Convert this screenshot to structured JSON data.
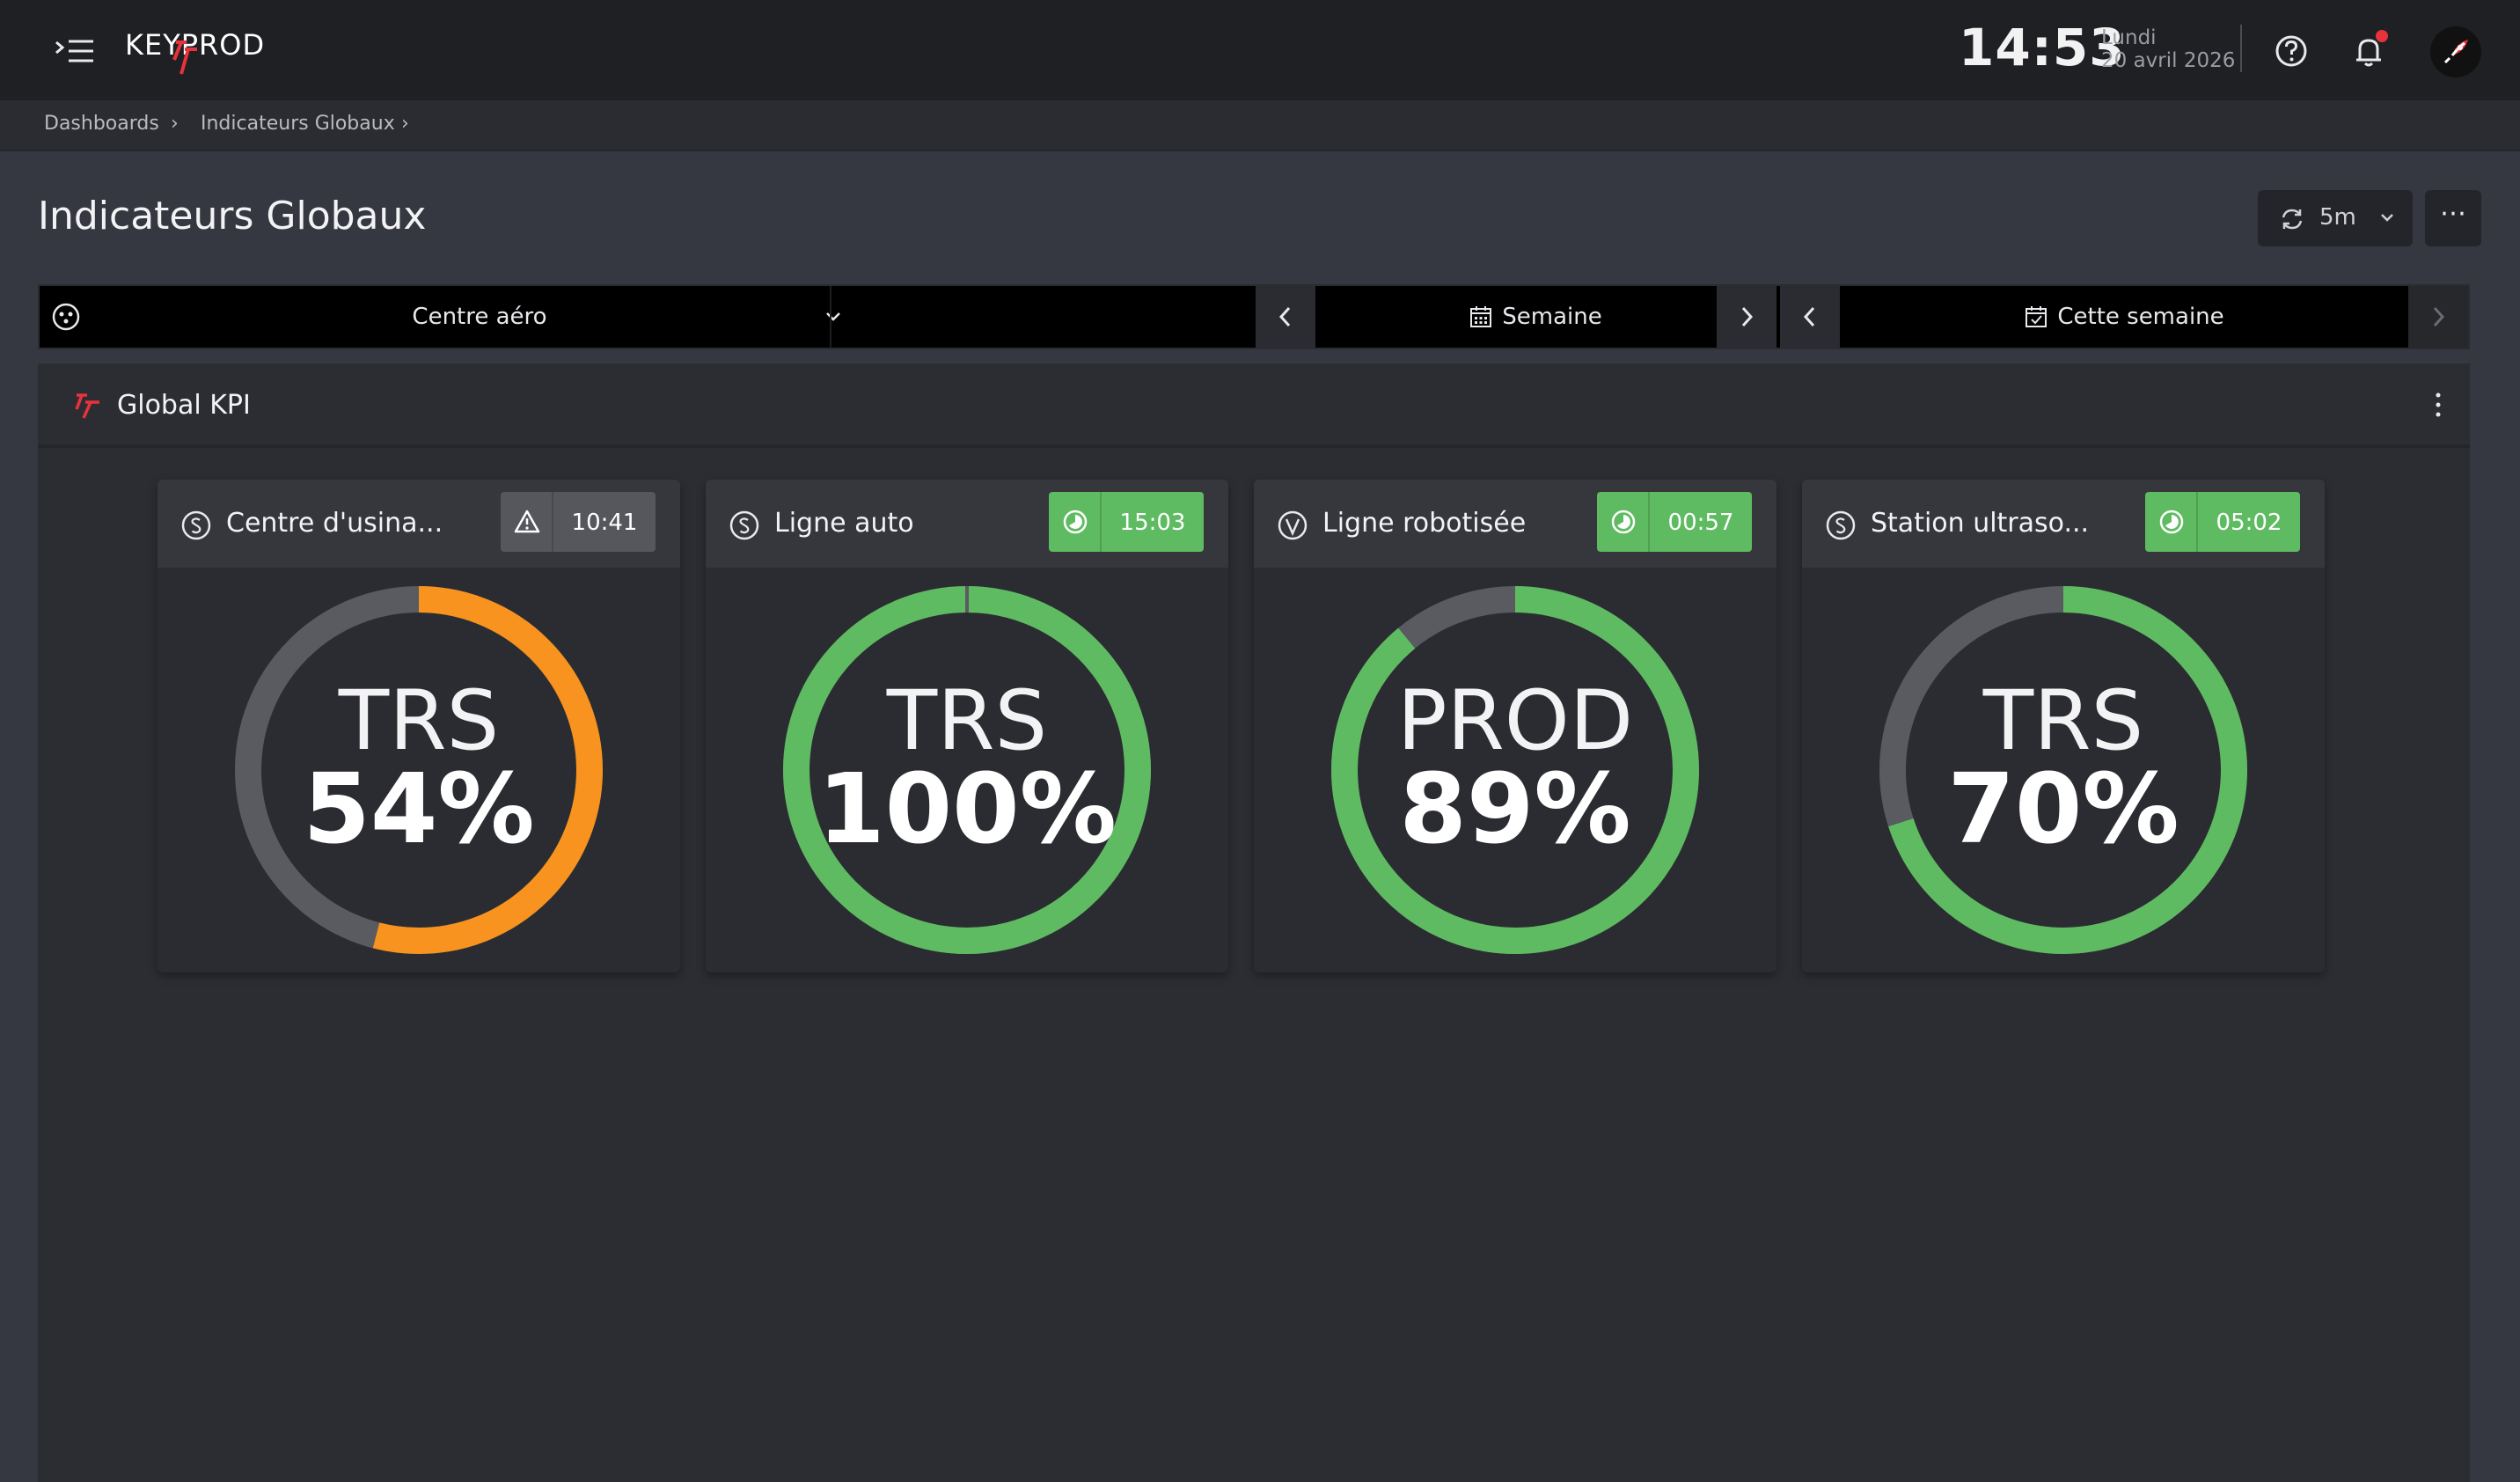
{
  "app": {
    "brand": "KEYPROD"
  },
  "topbar": {
    "time": "14:53",
    "day": "Lundi",
    "date": "20 avril 2026"
  },
  "breadcrumb": [
    {
      "label": "Dashboards"
    },
    {
      "label": "Indicateurs Globaux"
    }
  ],
  "page": {
    "title": "Indicateurs Globaux",
    "refresh_interval": "5m",
    "more_label": "⋯"
  },
  "filters": {
    "site": "Centre aéro",
    "period_type": "Semaine",
    "period": "Cette semaine"
  },
  "panel": {
    "title": "Global KPI"
  },
  "cards": [
    {
      "title": "Centre d'usina...",
      "icon": "s-circle-icon",
      "badge_time": "10:41",
      "badge_status": "warning",
      "badge_icon": "warning-triangle-icon",
      "badge_color": "#55575d",
      "kpi_label": "TRS",
      "kpi_value": "54%",
      "kpi_fraction": 0.54,
      "ring_color": "#f7931e"
    },
    {
      "title": "Ligne auto",
      "icon": "s-circle-icon",
      "badge_time": "15:03",
      "badge_status": "running",
      "badge_icon": "half-moon-icon",
      "badge_color": "#5fbb61",
      "kpi_label": "TRS",
      "kpi_value": "100%",
      "kpi_fraction": 1.0,
      "ring_color": "#5fbb61"
    },
    {
      "title": "Ligne robotisée",
      "icon": "v-circle-icon",
      "badge_time": "00:57",
      "badge_status": "running",
      "badge_icon": "half-moon-icon",
      "badge_color": "#5fbb61",
      "kpi_label": "PROD",
      "kpi_value": "89%",
      "kpi_fraction": 0.89,
      "ring_color": "#5fbb61"
    },
    {
      "title": "Station ultraso...",
      "icon": "s-circle-icon",
      "badge_time": "05:02",
      "badge_status": "running",
      "badge_icon": "half-moon-icon",
      "badge_color": "#5fbb61",
      "kpi_label": "TRS",
      "kpi_value": "70%",
      "kpi_fraction": 0.7,
      "ring_color": "#5fbb61"
    }
  ],
  "colors": {
    "track": "#595b61",
    "accent_red": "#e8323c"
  }
}
